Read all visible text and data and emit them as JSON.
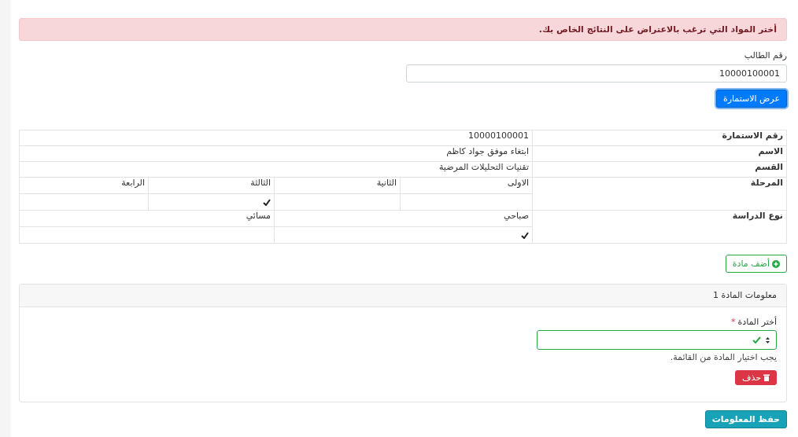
{
  "alert": {
    "text": "أختر المواد التي ترغب بالاعتراض على النتائج الخاص بك."
  },
  "student_id": {
    "label": "رقم الطالب",
    "value": "10000100001"
  },
  "show_button": "عرض الاستمارة",
  "info_rows": [
    {
      "label": "رقم الاستمارة",
      "value": "10000100001"
    },
    {
      "label": "الاسم",
      "value": "ابتغاء موفق جواد كاظم"
    },
    {
      "label": "القسم",
      "value": "تقنيات التحليلات المرضية"
    }
  ],
  "choice_rows": [
    {
      "label": "المرحلة",
      "options": [
        {
          "label": "الاولى",
          "selected": false
        },
        {
          "label": "الثانية",
          "selected": false
        },
        {
          "label": "الثالثة",
          "selected": true
        },
        {
          "label": "الرابعة",
          "selected": false
        }
      ]
    },
    {
      "label": "نوع الدراسة",
      "options": [
        {
          "label": "صباحي",
          "selected": true
        },
        {
          "label": "مسائي",
          "selected": false
        }
      ]
    }
  ],
  "add_button": "أضف مادة",
  "subject_panel": {
    "title": "معلومات المادة 1",
    "select_label": "أختر المادة",
    "required_mark": "*",
    "valid": true,
    "help_text": "يجب اختيار المادة من القائمة.",
    "delete_button": "حذف"
  },
  "save_button": "حفظ المعلومات"
}
